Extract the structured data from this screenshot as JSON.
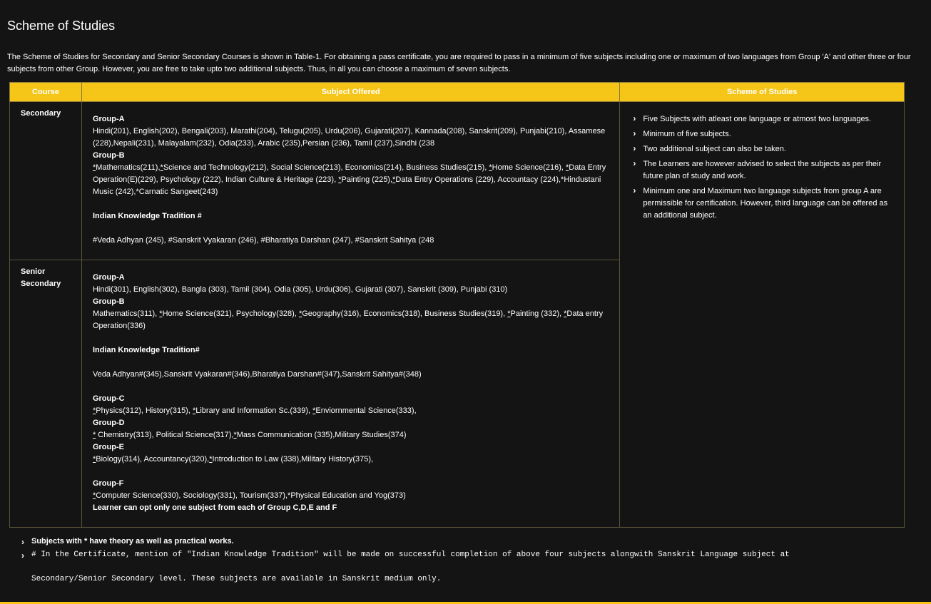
{
  "page": {
    "title": "Scheme of Studies",
    "intro": "The Scheme of Studies for Secondary and Senior Secondary Courses is shown in Table-1. For obtaining a pass certificate, you are required to pass in a minimum of five subjects including one or maximum of two languages from Group 'A' and other three or four subjects from other Group. However, you are free to take upto two additional subjects. Thus, in all you can choose a maximum of seven subjects."
  },
  "table": {
    "headers": {
      "course": "Course",
      "subject": "Subject Offered",
      "scheme": "Scheme of Studies"
    },
    "secondary": {
      "course": "Secondary",
      "group_a_label": "Group-A",
      "group_a": "Hindi(201), English(202), Bengali(203), Marathi(204), Telugu(205), Urdu(206), Gujarati(207), Kannada(208), Sanskrit(209), Punjabi(210), Assamese (228),Nepali(231), Malayalam(232), Odia(233), Arabic (235),Persian (236), Tamil (237),Sindhi (238",
      "group_b_label": "Group-B",
      "group_b": {
        "s1": "*",
        "t1": "Mathematics(211),",
        "s2": "*",
        "t2": "Science and Technology(212), Social Science(213), Economics(214), Business Studies(215), ",
        "s3": "*",
        "t3": "Home Science(216), ",
        "s4": "*",
        "t4": "Data Entry Operation(E)(229), Psychology (222), Indian Culture & Heritage (223), ",
        "s5": "*",
        "t5": "Painting (225),",
        "s6": "*",
        "t6": "Data Entry Operations (229), Accountacy (224),*Hindustani Music (242),*Carnatic Sangeet(243)"
      },
      "ikt_label": "Indian Knowledge Tradition #",
      "ikt": "#Veda Adhyan (245), #Sanskrit Vyakaran (246), #Bharatiya Darshan (247), #Sanskrit Sahitya (248"
    },
    "senior": {
      "course": "Senior Secondary",
      "group_a_label": "Group-A",
      "group_a": "Hindi(301), English(302), Bangla (303), Tamil (304), Odia (305), Urdu(306), Gujarati (307), Sanskrit (309), Punjabi (310)",
      "group_b_label": "Group-B",
      "group_b": {
        "t1": "Mathematics(311), ",
        "s2": "*",
        "t2": "Home Science(321), Psychology(328), ",
        "s3": "*",
        "t3": "Geography(316), Economics(318), Business Studies(319), ",
        "s4": "*",
        "t4": "Painting (332), ",
        "s5": "*",
        "t5": "Data entry Operation(336)"
      },
      "ikt_label": "Indian Knowledge Tradition#",
      "ikt": "Veda Adhyan#(345),Sanskrit Vyakaran#(346),Bharatiya Darshan#(347),Sanskrit Sahitya#(348)",
      "group_c_label": "Group-C",
      "group_c": {
        "s1": "*",
        "t1": "Physics(312), History(315), ",
        "s2": "*",
        "t2": "Library and Information Sc.(339),  ",
        "s3": "*",
        "t3": "Enviornmental Science(333),"
      },
      "group_d_label": "Group-D",
      "group_d": {
        "s1": "*",
        "t1": " Chemistry(313), Political Science(317),",
        "s2": "*",
        "t2": "Mass Communication (335),Military Studies(374)"
      },
      "group_e_label": "Group-E",
      "group_e": {
        "s1": "*",
        "t1": "Biology(314), Accountancy(320),",
        "s2": "*",
        "t2": "Introduction to Law (338),Military History(375),"
      },
      "group_f_label": "Group-F",
      "group_f": {
        "s1": "*",
        "t1": "Computer Science(330), Sociology(331),  Tourism(337),*Physical Education and Yog(373)"
      },
      "learner_note": "Learner can opt only one subject from each of Group C,D,E and F"
    },
    "scheme_items": [
      "Five Subjects with atleast one language or atmost two languages.",
      "Minimum of five subjects.",
      "Two additional subject can also be taken.",
      "The Learners are however advised to select the subjects as per their future plan of study and work.",
      "Minimum one and Maximum two language subjects from group A are permissible for certification. However, third language can be offered as an additional subject."
    ]
  },
  "notes": {
    "practical": "Subjects with * have theory as well as practical works.",
    "ikt": "# In the Certificate, mention of \"Indian Knowledge Tradition\" will be made on successful completion of above four subjects alongwith Sanskrit Language subject at",
    "ikt_cont": "Secondary/Senior Secondary level. These subjects are available in Sanskrit medium only."
  },
  "colors": {
    "accent": "#f5c518",
    "background": "#141414",
    "text": "#ffffff"
  }
}
